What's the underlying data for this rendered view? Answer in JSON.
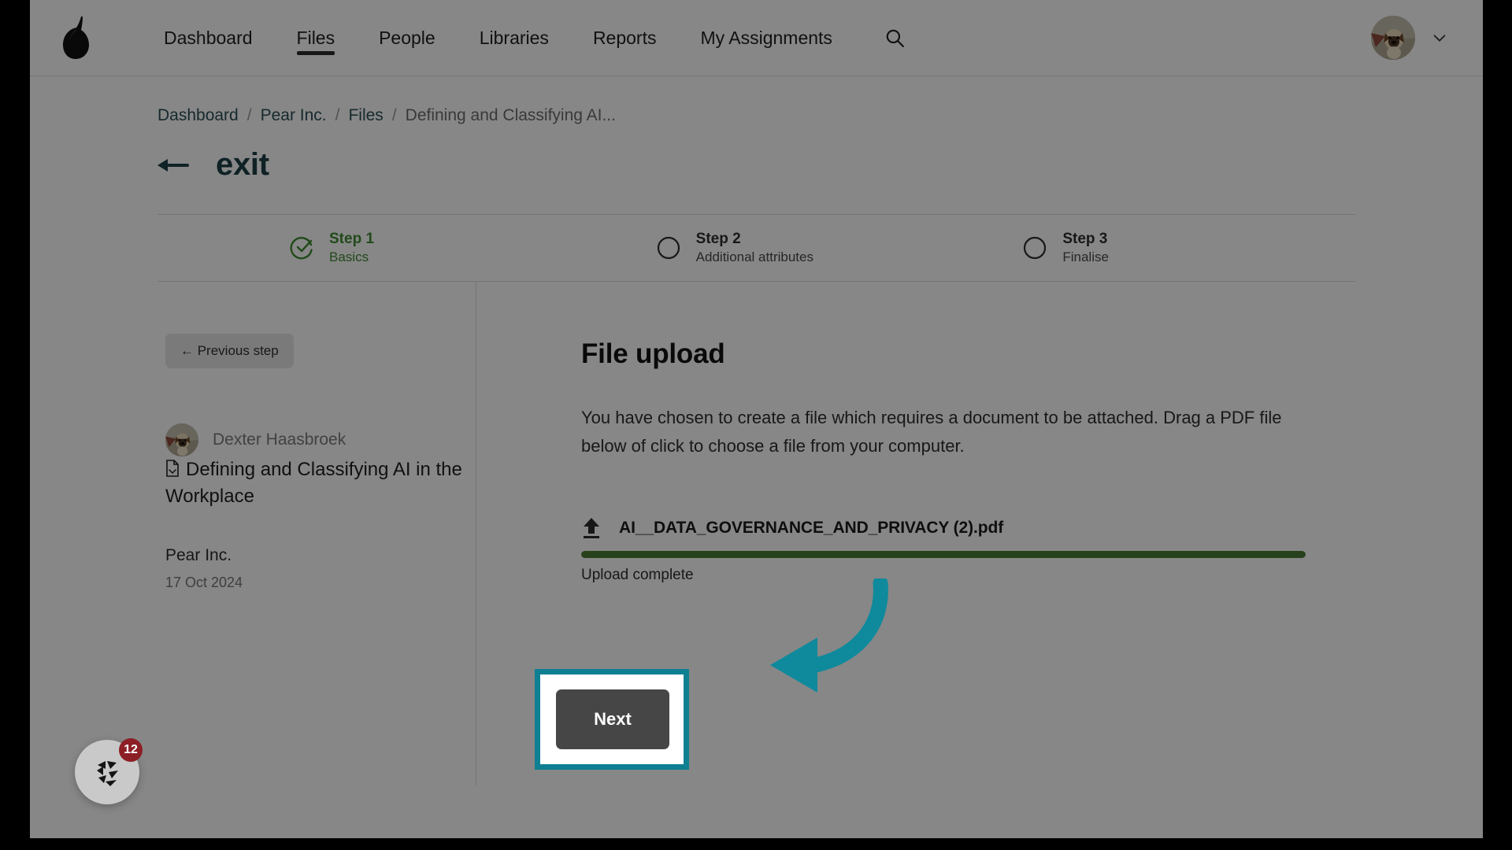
{
  "nav": {
    "logo_icon": "pear-logo-icon",
    "links": [
      {
        "label": "Dashboard",
        "active": false
      },
      {
        "label": "Files",
        "active": true
      },
      {
        "label": "People",
        "active": false
      },
      {
        "label": "Libraries",
        "active": false
      },
      {
        "label": "Reports",
        "active": false
      },
      {
        "label": "My Assignments",
        "active": false
      }
    ],
    "search_icon": "search-icon",
    "avatar_icon": "user-avatar-dog",
    "caret_icon": "chevron-down-icon"
  },
  "breadcrumb": {
    "items": [
      {
        "label": "Dashboard",
        "current": false
      },
      {
        "label": "Pear Inc.",
        "current": false
      },
      {
        "label": "Files",
        "current": false
      },
      {
        "label": "Defining and Classifying AI...",
        "current": true
      }
    ],
    "separator": "/"
  },
  "exit": {
    "label": "exit",
    "arrow_icon": "arrow-left-icon"
  },
  "stepper": {
    "steps": [
      {
        "title": "Step 1",
        "subtitle": "Basics",
        "state": "done",
        "icon": "check-circle-icon"
      },
      {
        "title": "Step 2",
        "subtitle": "Additional attributes",
        "state": "pending",
        "icon": "circle-icon"
      },
      {
        "title": "Step 3",
        "subtitle": "Finalise",
        "state": "pending",
        "icon": "circle-icon"
      }
    ]
  },
  "sidebar": {
    "previous_step_label": "← Previous step",
    "uploader_name": "Dexter Haasbroek",
    "document_title": "Defining and Classifying AI in the Workplace",
    "document_icon": "pdf-file-icon",
    "organisation": "Pear Inc.",
    "date": "17 Oct 2024"
  },
  "main": {
    "title": "File upload",
    "description": "You have chosen to create a file which requires a document to be attached. Drag a PDF file below of click to choose a file from your computer.",
    "upload": {
      "icon": "upload-icon",
      "filename": "AI__DATA_GOVERNANCE_AND_PRIVACY (2).pdf",
      "status": "Upload complete",
      "progress_percent": 100,
      "progress_color": "#4b7c35"
    },
    "next_label": "Next"
  },
  "annotation": {
    "arrow_icon": "curved-arrow-left-icon",
    "color": "#0f8a9c",
    "highlight_color": "#0f7f92"
  },
  "chat_widget": {
    "icon": "chat-launcher-icon",
    "badge_count": "12",
    "badge_color": "#8c1f25"
  }
}
